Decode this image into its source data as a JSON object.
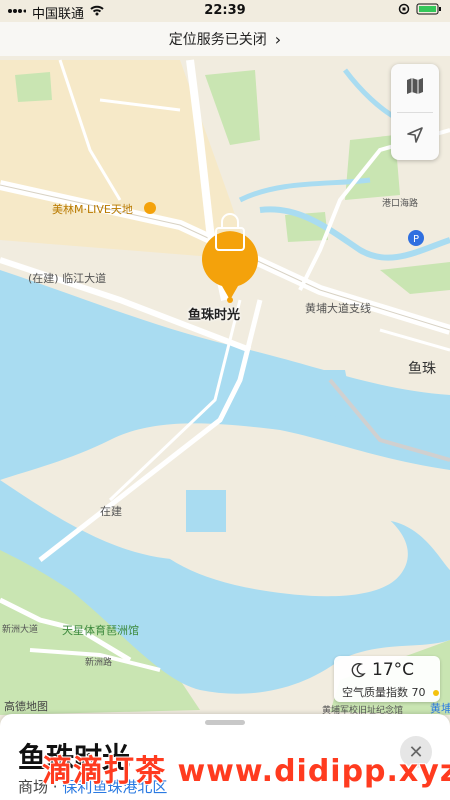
{
  "status_bar": {
    "carrier": "中国联通",
    "time": "22:39"
  },
  "location_banner": {
    "text": "定位服务已关闭"
  },
  "map": {
    "labels": {
      "meilin": "美林M·LIVE天地",
      "road_linjiang": "(在建) 临江大道",
      "road_huangpu": "黄埔大道支线",
      "yuzhu": "鱼珠",
      "zaijian": "在建",
      "tianxing": "天星体育琶洲馆",
      "xinzhou_road1": "新洲大道",
      "xinzhou_road2": "新洲路",
      "gangkou": "港口海路",
      "school": "黄埔军校旧址纪念馆",
      "amap": "高德地图",
      "huangpu_edge": "黄埔"
    },
    "pin": {
      "name": "鱼珠时光",
      "icon": "shopping-bag-icon",
      "color": "#f4a20b"
    },
    "colors": {
      "water": "#a9dcf1",
      "land": "#f1ecdf",
      "park": "#c9e5b2",
      "road": "#ffffff"
    }
  },
  "weather": {
    "temp": "17°C",
    "aqi_label": "空气质量指数",
    "aqi_value": "70",
    "icon": "moon-icon"
  },
  "sheet": {
    "title": "鱼珠时光",
    "category": "商场 · ",
    "area_link": "保利鱼珠港北区",
    "close_icon": "close-icon"
  },
  "watermark": "滴滴打茶 www.didipp.xyz"
}
